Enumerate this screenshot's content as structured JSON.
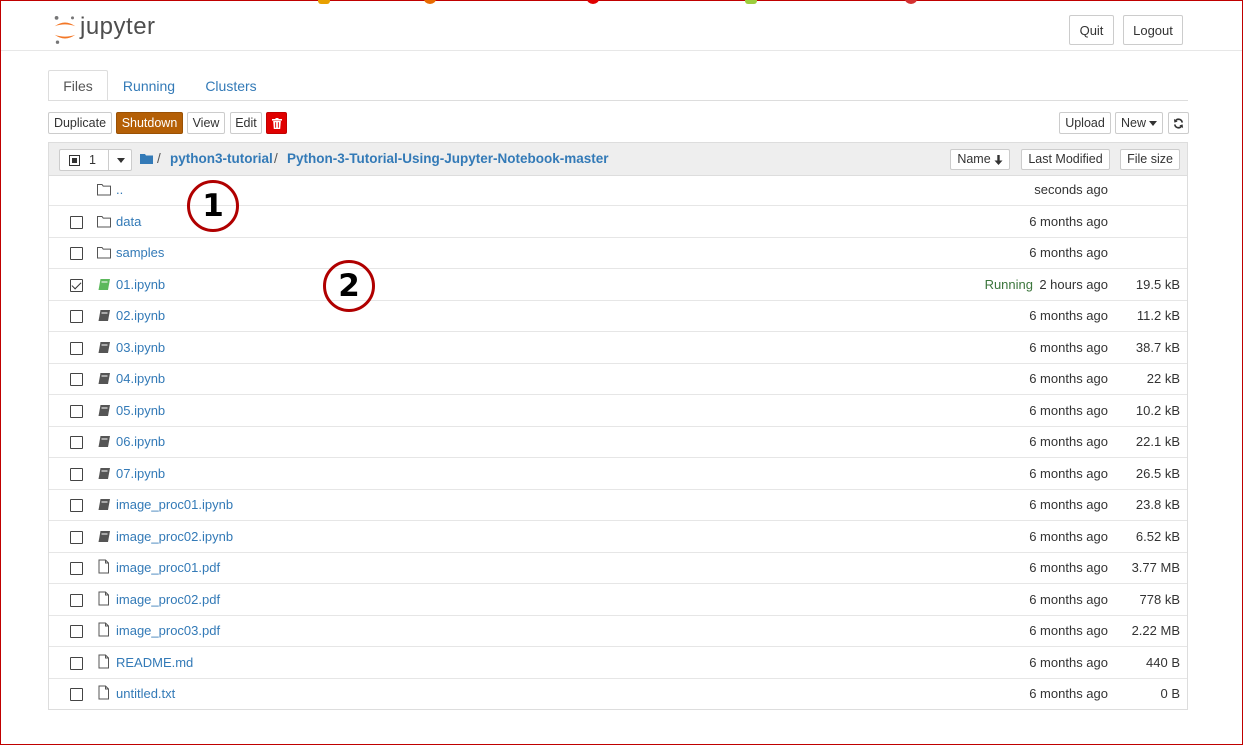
{
  "app": {
    "logo_text": "jupyter"
  },
  "header": {
    "quit_label": "Quit",
    "logout_label": "Logout"
  },
  "tabs": [
    {
      "label": "Files",
      "active": true
    },
    {
      "label": "Running",
      "active": false
    },
    {
      "label": "Clusters",
      "active": false
    }
  ],
  "toolbar": {
    "duplicate_label": "Duplicate",
    "shutdown_label": "Shutdown",
    "view_label": "View",
    "edit_label": "Edit",
    "delete_icon": "trash-icon",
    "upload_label": "Upload",
    "new_label": "New",
    "refresh_icon": "refresh-icon"
  },
  "list_header": {
    "selected_count": "1",
    "breadcrumb": [
      "python3-tutorial",
      "Python-3-Tutorial-Using-Jupyter-Notebook-master"
    ],
    "separator": "/",
    "sort_name_label": "Name",
    "sort_modified_label": "Last Modified",
    "sort_size_label": "File size"
  },
  "files": [
    {
      "name": "..",
      "type": "folder",
      "modified": "seconds ago",
      "size": "",
      "status": "",
      "checked": false,
      "has_checkbox": false
    },
    {
      "name": "data",
      "type": "folder",
      "modified": "6 months ago",
      "size": "",
      "status": "",
      "checked": false,
      "has_checkbox": true
    },
    {
      "name": "samples",
      "type": "folder",
      "modified": "6 months ago",
      "size": "",
      "status": "",
      "checked": false,
      "has_checkbox": true
    },
    {
      "name": "01.ipynb",
      "type": "notebook-running",
      "modified": "2 hours ago",
      "size": "19.5 kB",
      "status": "Running",
      "checked": true,
      "has_checkbox": true
    },
    {
      "name": "02.ipynb",
      "type": "notebook",
      "modified": "6 months ago",
      "size": "11.2 kB",
      "status": "",
      "checked": false,
      "has_checkbox": true
    },
    {
      "name": "03.ipynb",
      "type": "notebook",
      "modified": "6 months ago",
      "size": "38.7 kB",
      "status": "",
      "checked": false,
      "has_checkbox": true
    },
    {
      "name": "04.ipynb",
      "type": "notebook",
      "modified": "6 months ago",
      "size": "22 kB",
      "status": "",
      "checked": false,
      "has_checkbox": true
    },
    {
      "name": "05.ipynb",
      "type": "notebook",
      "modified": "6 months ago",
      "size": "10.2 kB",
      "status": "",
      "checked": false,
      "has_checkbox": true
    },
    {
      "name": "06.ipynb",
      "type": "notebook",
      "modified": "6 months ago",
      "size": "22.1 kB",
      "status": "",
      "checked": false,
      "has_checkbox": true
    },
    {
      "name": "07.ipynb",
      "type": "notebook",
      "modified": "6 months ago",
      "size": "26.5 kB",
      "status": "",
      "checked": false,
      "has_checkbox": true
    },
    {
      "name": "image_proc01.ipynb",
      "type": "notebook",
      "modified": "6 months ago",
      "size": "23.8 kB",
      "status": "",
      "checked": false,
      "has_checkbox": true
    },
    {
      "name": "image_proc02.ipynb",
      "type": "notebook",
      "modified": "6 months ago",
      "size": "6.52 kB",
      "status": "",
      "checked": false,
      "has_checkbox": true
    },
    {
      "name": "image_proc01.pdf",
      "type": "file",
      "modified": "6 months ago",
      "size": "3.77 MB",
      "status": "",
      "checked": false,
      "has_checkbox": true
    },
    {
      "name": "image_proc02.pdf",
      "type": "file",
      "modified": "6 months ago",
      "size": "778 kB",
      "status": "",
      "checked": false,
      "has_checkbox": true
    },
    {
      "name": "image_proc03.pdf",
      "type": "file",
      "modified": "6 months ago",
      "size": "2.22 MB",
      "status": "",
      "checked": false,
      "has_checkbox": true
    },
    {
      "name": "README.md",
      "type": "file",
      "modified": "6 months ago",
      "size": "440 B",
      "status": "",
      "checked": false,
      "has_checkbox": true
    },
    {
      "name": "untitled.txt",
      "type": "file",
      "modified": "6 months ago",
      "size": "0 B",
      "status": "",
      "checked": false,
      "has_checkbox": true
    }
  ],
  "annotations": [
    {
      "label": "1"
    },
    {
      "label": "2"
    }
  ],
  "colors": {
    "frame": "#c00000",
    "shutdown_bg": "#b45f06",
    "delete_bg": "#e00000",
    "link": "#337ab7",
    "running": "#3c763d",
    "notebook_running": "#5cb85c",
    "annotation_ring": "#b00000"
  }
}
